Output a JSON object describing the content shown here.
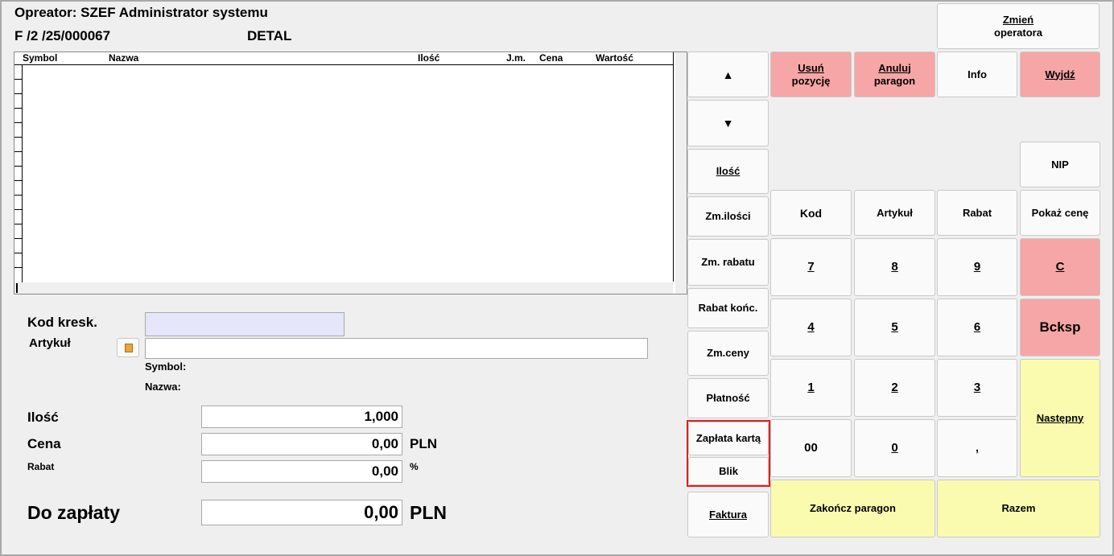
{
  "header": {
    "operator_line": "Opreator: SZEF Administrator systemu",
    "document_number": "F /2  /25/000067",
    "price_mode": "DETAL"
  },
  "grid": {
    "columns": [
      "Symbol",
      "Nazwa",
      "Ilość",
      "J.m.",
      "Cena",
      "Wartość"
    ],
    "rows": []
  },
  "form": {
    "barcode_label": "Kod kresk.",
    "barcode_value": "",
    "article_label": "Artykuł",
    "article_value": "",
    "symbol_label": "Symbol:",
    "name_label": "Nazwa:",
    "quantity_label": "Ilość",
    "quantity_value": "1,000",
    "price_label": "Cena",
    "price_value": "0,00",
    "price_unit": "PLN",
    "discount_label": "Rabat",
    "discount_value": "0,00",
    "discount_unit": "%",
    "to_pay_label": "Do zapłaty",
    "to_pay_value": "0,00",
    "to_pay_unit": "PLN"
  },
  "buttons": {
    "change_operator_1": "Zmień",
    "change_operator_2": "operatora",
    "arrow_up": "▲",
    "arrow_down": "▼",
    "quantity": "Ilość",
    "change_quantity": "Zm.ilości",
    "change_discount": "Zm. rabatu",
    "final_discount": "Rabat końc.",
    "change_price": "Zm.ceny",
    "payment": "Płatność",
    "card_payment": "Zapłata kartą",
    "blik": "Blik",
    "invoice": "Faktura",
    "delete_item_1": "Usuń",
    "delete_item_2": "pozycję",
    "cancel_receipt_1": "Anuluj",
    "cancel_receipt_2": "paragon",
    "info": "Info",
    "exit": "Wyjdź",
    "nip": "NIP",
    "code": "Kod",
    "article": "Artykuł",
    "discount": "Rabat",
    "show_price": "Pokaż cenę",
    "k7": "7",
    "k8": "8",
    "k9": "9",
    "clear": "C",
    "k4": "4",
    "k5": "5",
    "k6": "6",
    "backspace": "Bcksp",
    "k1": "1",
    "k2": "2",
    "k3": "3",
    "next": "Następny",
    "k00": "00",
    "k0": "0",
    "dot": ",",
    "finish_receipt": "Zakończ paragon",
    "total": "Razem"
  },
  "colors": {
    "red_button": "#f6a6a6",
    "yellow_button": "#fbfbb0",
    "highlight": "#e11d1d",
    "barcode_field": "#e6e6fa"
  }
}
